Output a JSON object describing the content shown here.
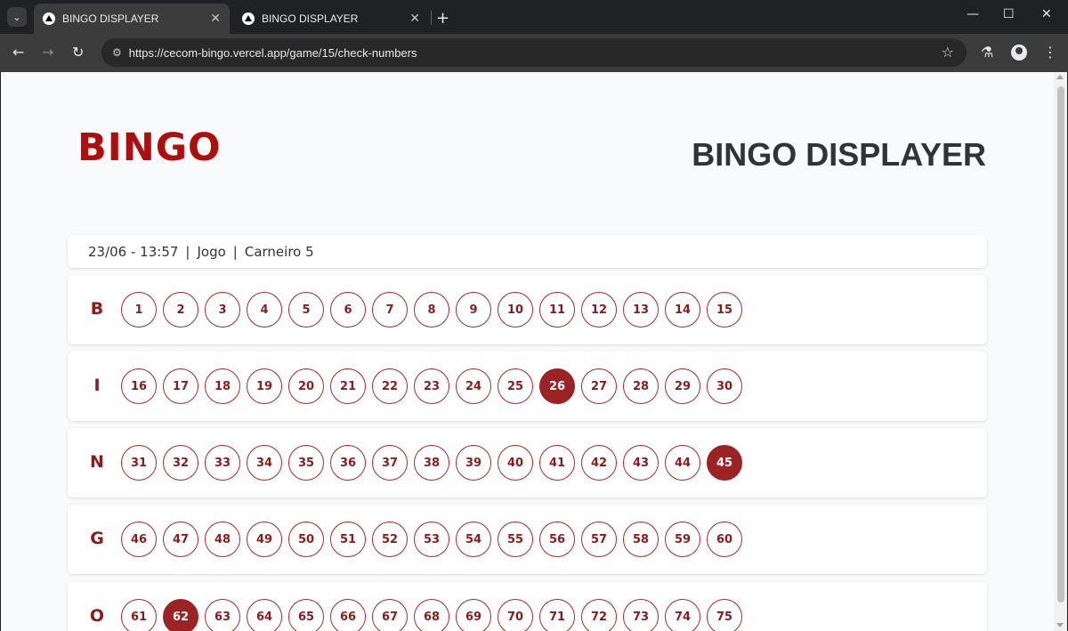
{
  "browser": {
    "tabs": [
      {
        "title": "BINGO DISPLAYER",
        "active": true
      },
      {
        "title": "BINGO DISPLAYER",
        "active": false
      }
    ],
    "url": "https://cecom-bingo.vercel.app/game/15/check-numbers",
    "tab_search_icon": "chevron-down-icon",
    "close_glyph": "✕",
    "new_tab_glyph": "+",
    "back_glyph": "←",
    "forward_glyph": "→",
    "reload_glyph": "↻",
    "star_glyph": "☆",
    "labs_glyph": "⚗",
    "menu_glyph": "⋮",
    "minimize_glyph": "—",
    "maximize_glyph": "☐",
    "window_close_glyph": "✕",
    "site_settings_glyph": "⚙"
  },
  "page": {
    "logo": "BINGO",
    "title": "BINGO DISPLAYER",
    "info": {
      "datetime": "23/06 - 13:57",
      "separator": "|",
      "game_type": "Jogo",
      "game_name": "Carneiro 5"
    },
    "rows": [
      {
        "letter": "B",
        "numbers": [
          "1",
          "2",
          "3",
          "4",
          "5",
          "6",
          "7",
          "8",
          "9",
          "10",
          "11",
          "12",
          "13",
          "14",
          "15"
        ]
      },
      {
        "letter": "I",
        "numbers": [
          "16",
          "17",
          "18",
          "19",
          "20",
          "21",
          "22",
          "23",
          "24",
          "25",
          "26",
          "27",
          "28",
          "29",
          "30"
        ]
      },
      {
        "letter": "N",
        "numbers": [
          "31",
          "32",
          "33",
          "34",
          "35",
          "36",
          "37",
          "38",
          "39",
          "40",
          "41",
          "42",
          "43",
          "44",
          "45"
        ]
      },
      {
        "letter": "G",
        "numbers": [
          "46",
          "47",
          "48",
          "49",
          "50",
          "51",
          "52",
          "53",
          "54",
          "55",
          "56",
          "57",
          "58",
          "59",
          "60"
        ]
      },
      {
        "letter": "O",
        "numbers": [
          "61",
          "62",
          "63",
          "64",
          "65",
          "66",
          "67",
          "68",
          "69",
          "70",
          "71",
          "72",
          "73",
          "74",
          "75"
        ]
      }
    ],
    "drawn_numbers": [
      "26",
      "45",
      "62"
    ],
    "colors": {
      "accent": "#9b2323",
      "logo": "#b00e0e",
      "background": "#f9fafb"
    }
  }
}
